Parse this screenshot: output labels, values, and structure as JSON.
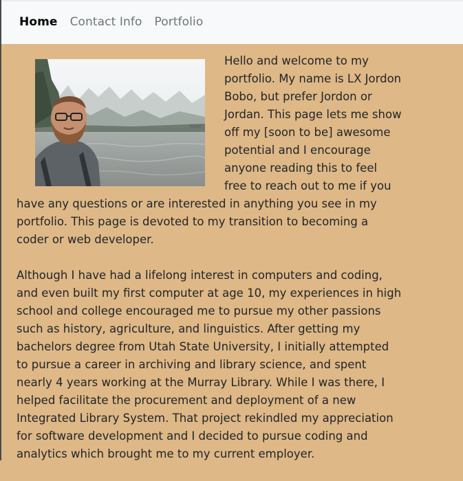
{
  "nav": {
    "items": [
      {
        "label": "Home",
        "active": true
      },
      {
        "label": "Contact Info",
        "active": false
      },
      {
        "label": "Portfolio",
        "active": false
      }
    ]
  },
  "main": {
    "paragraph1": "Hello and welcome to my portfolio. My name is LX Jordon Bobo, but prefer Jordon or Jordan. This page lets me show off my [soon to be] awesome potential and I encourage anyone reading this to feel free to reach out to me if you have any questions or are interested in anything you see in my portfolio. This page is devoted to my transition to becoming a coder or web developer.",
    "paragraph2": "Although I have had a lifelong interest in computers and coding, and even built my first computer at age 10, my experiences in high school and college encouraged me to pursue my other passions such as history, agriculture, and linguistics. After getting my bachelors degree from Utah State University, I initially attempted to pursue a career in archiving and library science, and spent nearly 4 years working at the Murray Library. While I was there, I helped facilitate the procurement and deployment of a new Integrated Library System. That project rekindled my appreciation for software development and I decided to pursue coding and analytics which brought me to my current employer."
  },
  "colors": {
    "page_background": "#deb887",
    "navbar_background": "#f8f9fa"
  }
}
